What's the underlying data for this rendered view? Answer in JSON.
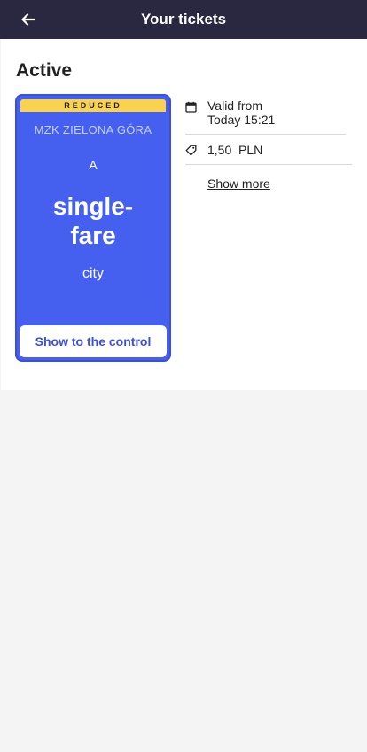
{
  "header": {
    "title": "Your tickets",
    "back_icon": "arrow-left-icon"
  },
  "section": {
    "title": "Active"
  },
  "ticket": {
    "badge": "REDUCED",
    "operator": "MZK ZIELONA GÓRA",
    "zone": "A",
    "type_line1": "single-",
    "type_line2": "fare",
    "area": "city",
    "control_button": "Show to the control",
    "card_color": "#4560ef",
    "badge_color": "#f9d24e"
  },
  "details": {
    "valid_label": "Valid from",
    "valid_value": "Today 15:21",
    "valid_icon": "calendar-icon",
    "price": "1,50  PLN",
    "price_icon": "tag-icon",
    "show_more": "Show more"
  }
}
